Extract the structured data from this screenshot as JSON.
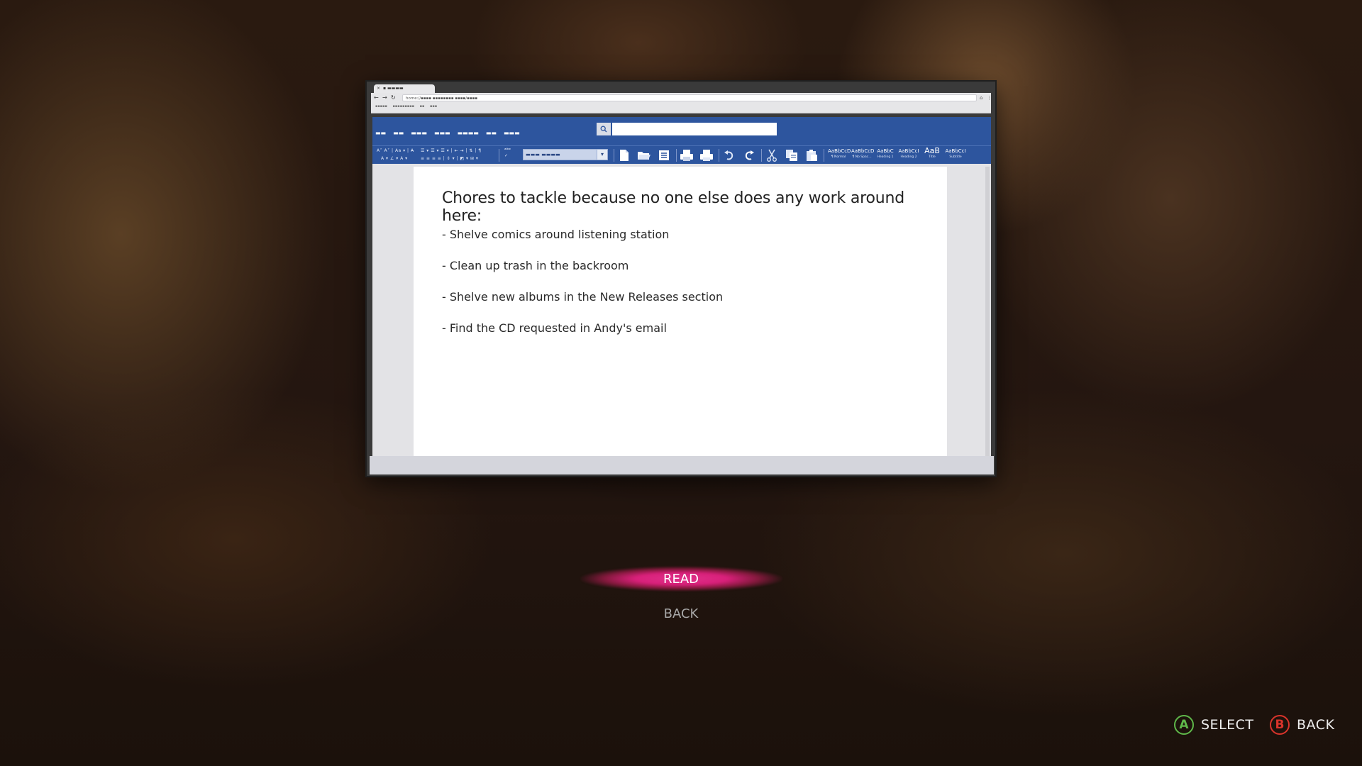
{
  "browser": {
    "tab_title": "▪ ▬▬▬▬",
    "tab_close": "×",
    "url": "home://▪▪▪▪ ▪▪▪▪▪▪▪▪ ▪▪▪▪/▪▪▪▪",
    "bookmarks": "▪▪▪▪▪ ▪▪▪▪▪▪▪▪▪ ▪▪ ▪▪▪"
  },
  "editor": {
    "menu_items": [
      "▬▬",
      "▬▬",
      "▬▬▬",
      "▬▬▬",
      "▬▬▬▬",
      "▬▬",
      "▬▬▬"
    ],
    "font_name": "▬▬▬ ▬▬▬▬",
    "styles": [
      {
        "sample": "AaBbCcD",
        "label": "¶ Normal"
      },
      {
        "sample": "AaBbCcD",
        "label": "¶ No Spac..."
      },
      {
        "sample": "AaBbC",
        "label": "Heading 1"
      },
      {
        "sample": "AaBbCcI",
        "label": "Heading 2"
      },
      {
        "sample": "AaB",
        "label": "Title"
      },
      {
        "sample": "AaBbCcI",
        "label": "Subtitle"
      }
    ]
  },
  "document": {
    "title": "Chores to tackle because no one else does any work around here:",
    "items": [
      "- Shelve comics around listening station",
      "- Clean up trash in the backroom",
      "- Shelve new albums in the New Releases section",
      "- Find the CD requested in Andy's email"
    ]
  },
  "menu": {
    "read": "READ",
    "back": "BACK"
  },
  "hints": {
    "a_button": "A",
    "a_label": "SELECT",
    "a_color": "#5fb84a",
    "b_button": "B",
    "b_label": "BACK",
    "b_color": "#d9342b"
  },
  "colors": {
    "editor_blue": "#2d559e",
    "read_highlight": "#d8207a"
  }
}
